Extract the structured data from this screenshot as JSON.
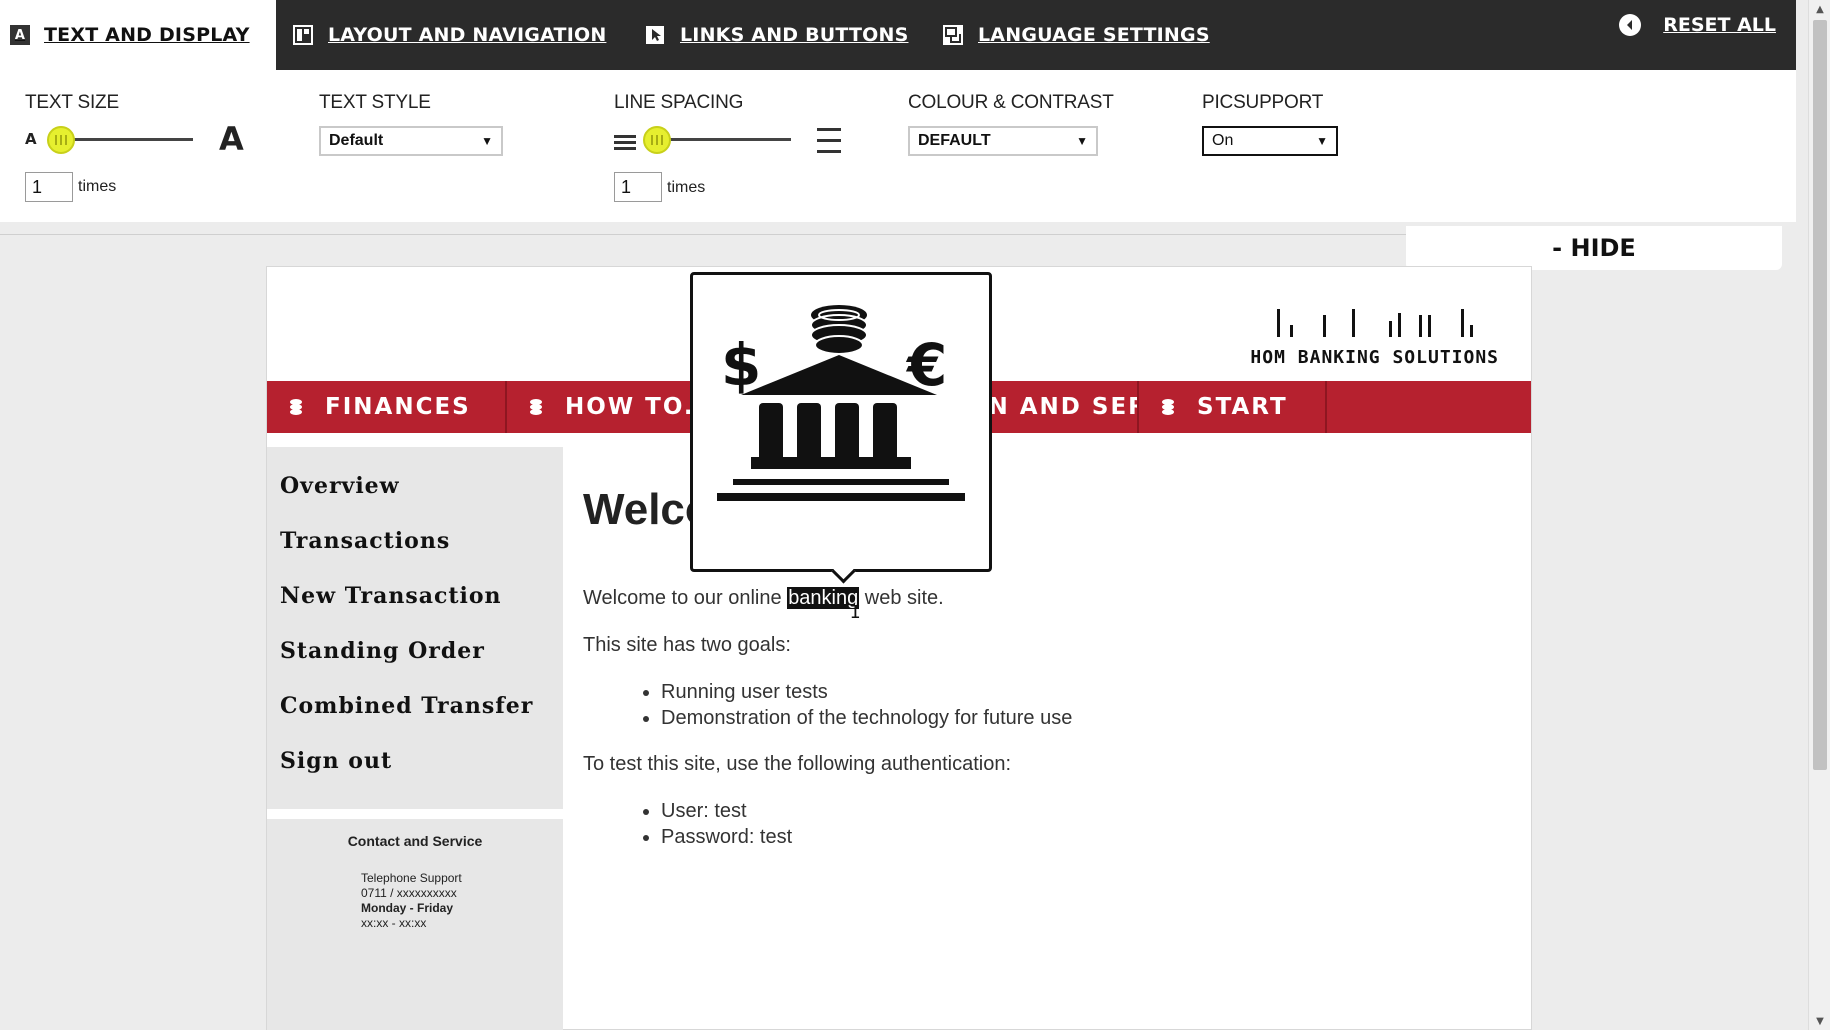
{
  "toolbar": {
    "tabs": [
      {
        "label": "TEXT AND DISPLAY",
        "icon": "A"
      },
      {
        "label": "LAYOUT AND NAVIGATION"
      },
      {
        "label": "LINKS AND BUTTONS"
      },
      {
        "label": "LANGUAGE SETTINGS"
      }
    ],
    "reset_label": "RESET ALL",
    "hide_label": "- HIDE"
  },
  "controls": {
    "text_size": {
      "label": "TEXT SIZE",
      "small_glyph": "A",
      "large_glyph": "A",
      "value": "1",
      "unit": "times",
      "level": 0
    },
    "text_style": {
      "label": "TEXT STYLE",
      "value": "Default"
    },
    "line_spacing": {
      "label": "LINE SPACING",
      "value": "1",
      "unit": "times",
      "level": 0
    },
    "colour_contrast": {
      "label": "COLOUR & CONTRAST",
      "value": "DEFAULT"
    },
    "picsupport": {
      "label": "PICSUPPORT",
      "value": "On"
    }
  },
  "site": {
    "logo_text": "HOM BANKING SOLUTIONS",
    "nav": [
      {
        "label": "FINANCES"
      },
      {
        "label": "HOW TO..."
      },
      {
        "label": "INFORMATION AND SERVICE"
      },
      {
        "label": "START"
      }
    ],
    "sidenav": [
      "Overview",
      "Transactions",
      "New Transaction",
      "Standing Order",
      "Combined Transfer",
      "Sign out"
    ],
    "contact": {
      "title": "Contact and Service",
      "lines": [
        "Telephone Support",
        "0711 / xxxxxxxxxx",
        "Monday - Friday",
        "xx:xx - xx:xx"
      ]
    },
    "main": {
      "heading": "Welcome",
      "p1_before": "Welcome to our online ",
      "p1_highlight": "banking",
      "p1_after": " web site.",
      "p2": "This site has two goals:",
      "goals": [
        "Running user tests",
        "Demonstration of the technology for future use"
      ],
      "p3": "To test this site, use the following authentication:",
      "auth": [
        "User: test",
        "Password: test"
      ]
    },
    "popup": {
      "icon": "bank-icon",
      "symbols": [
        "$",
        "€"
      ]
    }
  },
  "colors": {
    "nav_red": "#b6212f",
    "toolbar_dark": "#2b2b2b",
    "knob_yellow": "#e6ef2f"
  }
}
